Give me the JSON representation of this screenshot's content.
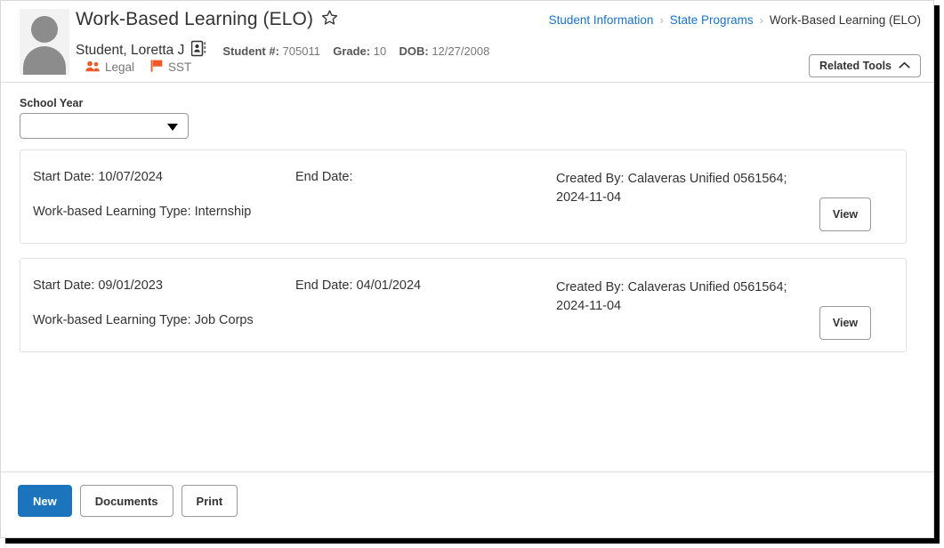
{
  "window": {
    "header": {
      "page_title": "Work-Based Learning (ELO)",
      "favorite_icon": "star-outline-icon",
      "avatar_icon": "person-placeholder-avatar",
      "student_name": "Student, Loretta J",
      "student_card_icon": "id-card-icon",
      "meta": {
        "student_number_label": "Student #:",
        "student_number_value": "705011",
        "grade_label": "Grade:",
        "grade_value": "10",
        "dob_label": "DOB:",
        "dob_value": "12/27/2008"
      },
      "flags": [
        {
          "icon": "people-icon",
          "label": "Legal",
          "color": "#F05A28"
        },
        {
          "icon": "flag-icon",
          "label": "SST",
          "color": "#F05A28"
        }
      ],
      "breadcrumb": {
        "items": [
          {
            "label": "Student Information",
            "link": true
          },
          {
            "label": "State Programs",
            "link": true
          },
          {
            "label": "Work-Based Learning (ELO)",
            "link": false
          }
        ],
        "separator": "›"
      },
      "related_tools": {
        "label": "Related Tools",
        "icon": "chevron-up-icon"
      }
    },
    "content": {
      "school_year": {
        "label": "School Year",
        "value": "",
        "placeholder": "",
        "caret_icon": "chevron-down-icon"
      },
      "records": [
        {
          "start_date_label": "Start Date:",
          "start_date_value": "10/07/2024",
          "end_date_label": "End Date:",
          "end_date_value": "",
          "type_label": "Work-based Learning Type:",
          "type_value": "Internship",
          "created_by_label": "Created By:",
          "created_by_value": "Calaveras Unified 0561564; 2024-11-04",
          "view_label": "View"
        },
        {
          "start_date_label": "Start Date:",
          "start_date_value": "09/01/2023",
          "end_date_label": "End Date:",
          "end_date_value": "04/01/2024",
          "type_label": "Work-based Learning Type:",
          "type_value": "Job Corps",
          "created_by_label": "Created By:",
          "created_by_value": "Calaveras Unified 0561564; 2024-11-04",
          "view_label": "View"
        }
      ]
    },
    "footer": {
      "new_label": "New",
      "documents_label": "Documents",
      "print_label": "Print",
      "primary_color": "#1C75BC"
    }
  }
}
